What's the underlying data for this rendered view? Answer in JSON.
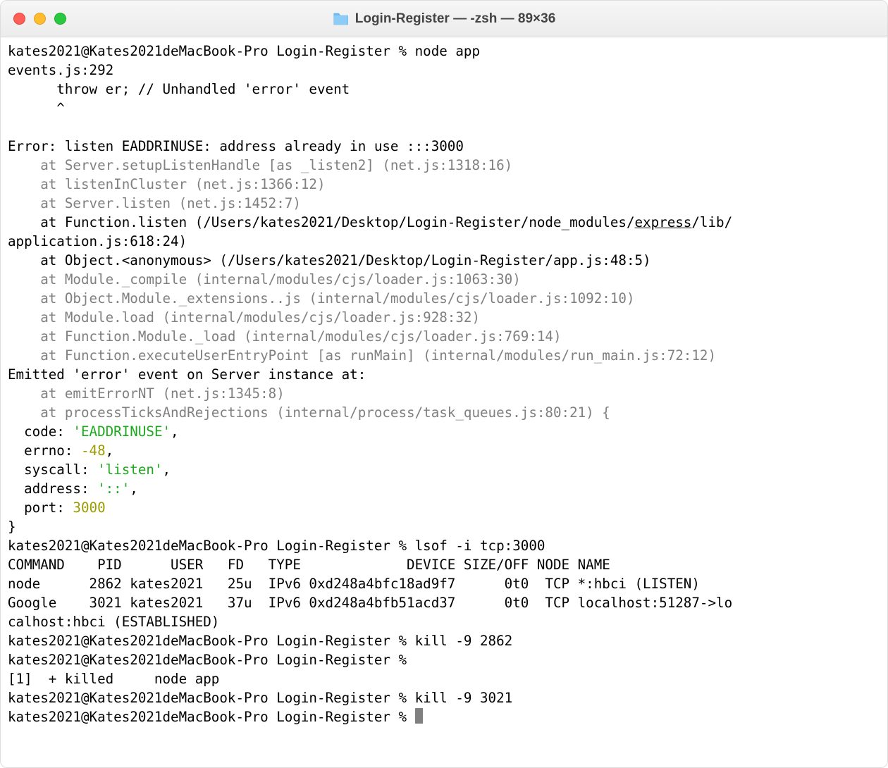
{
  "window": {
    "title": "Login-Register — -zsh — 89×36"
  },
  "terminal": {
    "prompt": "kates2021@Kates2021deMacBook-Pro Login-Register % ",
    "cmd_node": "node app",
    "events_line": "events.js:292",
    "throw_line": "      throw er; // Unhandled 'error' event",
    "caret_line": "      ^",
    "blank": "",
    "error_line": "Error: listen EADDRINUSE: address already in use :::3000",
    "stack1": "    at Server.setupListenHandle [as _listen2] (net.js:1318:16)",
    "stack2": "    at listenInCluster (net.js:1366:12)",
    "stack3": "    at Server.listen (net.js:1452:7)",
    "stack4a": "    at Function.listen (/Users/kates2021/Desktop/Login-Register/node_modules/",
    "stack4b": "express",
    "stack4c": "/lib/",
    "stack4d": "application.js:618:24)",
    "stack5": "    at Object.<anonymous> (/Users/kates2021/Desktop/Login-Register/app.js:48:5)",
    "stack6": "    at Module._compile (internal/modules/cjs/loader.js:1063:30)",
    "stack7": "    at Object.Module._extensions..js (internal/modules/cjs/loader.js:1092:10)",
    "stack8": "    at Module.load (internal/modules/cjs/loader.js:928:32)",
    "stack9": "    at Function.Module._load (internal/modules/cjs/loader.js:769:14)",
    "stack10": "    at Function.executeUserEntryPoint [as runMain] (internal/modules/run_main.js:72:12)",
    "emitted_line": "Emitted 'error' event on Server instance at:",
    "emit1": "    at emitErrorNT (net.js:1345:8)",
    "emit2": "    at processTicksAndRejections (internal/process/task_queues.js:80:21) {",
    "obj_code_key": "  code: ",
    "obj_code_val": "'EADDRINUSE'",
    "obj_errno_key": "  errno: ",
    "obj_errno_val": "-48",
    "obj_syscall_key": "  syscall: ",
    "obj_syscall_val": "'listen'",
    "obj_address_key": "  address: ",
    "obj_address_val": "'::'",
    "obj_port_key": "  port: ",
    "obj_port_val": "3000",
    "obj_close": "}",
    "cmd_lsof": "lsof -i tcp:3000",
    "lsof_header": "COMMAND    PID      USER   FD   TYPE             DEVICE SIZE/OFF NODE NAME",
    "lsof_row1": "node      2862 kates2021   25u  IPv6 0xd248a4bfc18ad9f7      0t0  TCP *:hbci (LISTEN)",
    "lsof_row2a": "Google    3021 kates2021   37u  IPv6 0xd248a4bfb51acd37      0t0  TCP localhost:51287->lo",
    "lsof_row2b": "calhost:hbci (ESTABLISHED)",
    "cmd_kill1": "kill -9 2862",
    "killed_line": "[1]  + killed     node app",
    "cmd_kill2": "kill -9 3021",
    "comma": ","
  }
}
